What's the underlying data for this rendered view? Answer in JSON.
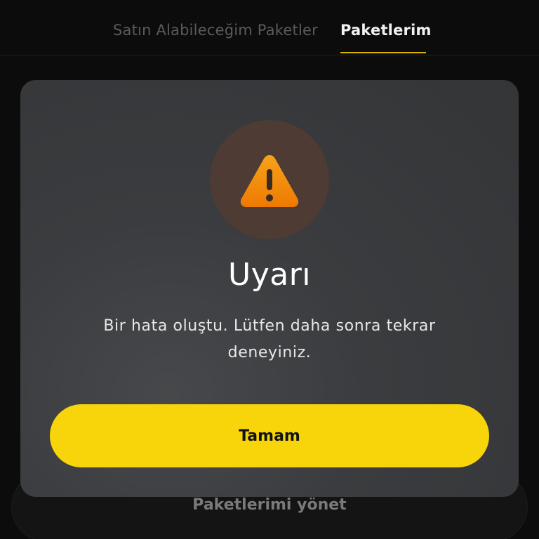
{
  "tabs": [
    {
      "label": "Satın Alabileceğim Paketler",
      "active": false
    },
    {
      "label": "Paketlerim",
      "active": true
    }
  ],
  "background": {
    "manage_button_label": "Paketlerimi yönet"
  },
  "dialog": {
    "icon": "warning-triangle-icon",
    "title": "Uyarı",
    "message": "Bir hata oluştu. Lütfen daha sonra tekrar deneyiniz.",
    "button_label": "Tamam"
  },
  "colors": {
    "accent": "#f7d50a",
    "warning": "#f08c00",
    "tab_indicator": "#d8b400",
    "dialog_bg": "#3a3c3f"
  }
}
